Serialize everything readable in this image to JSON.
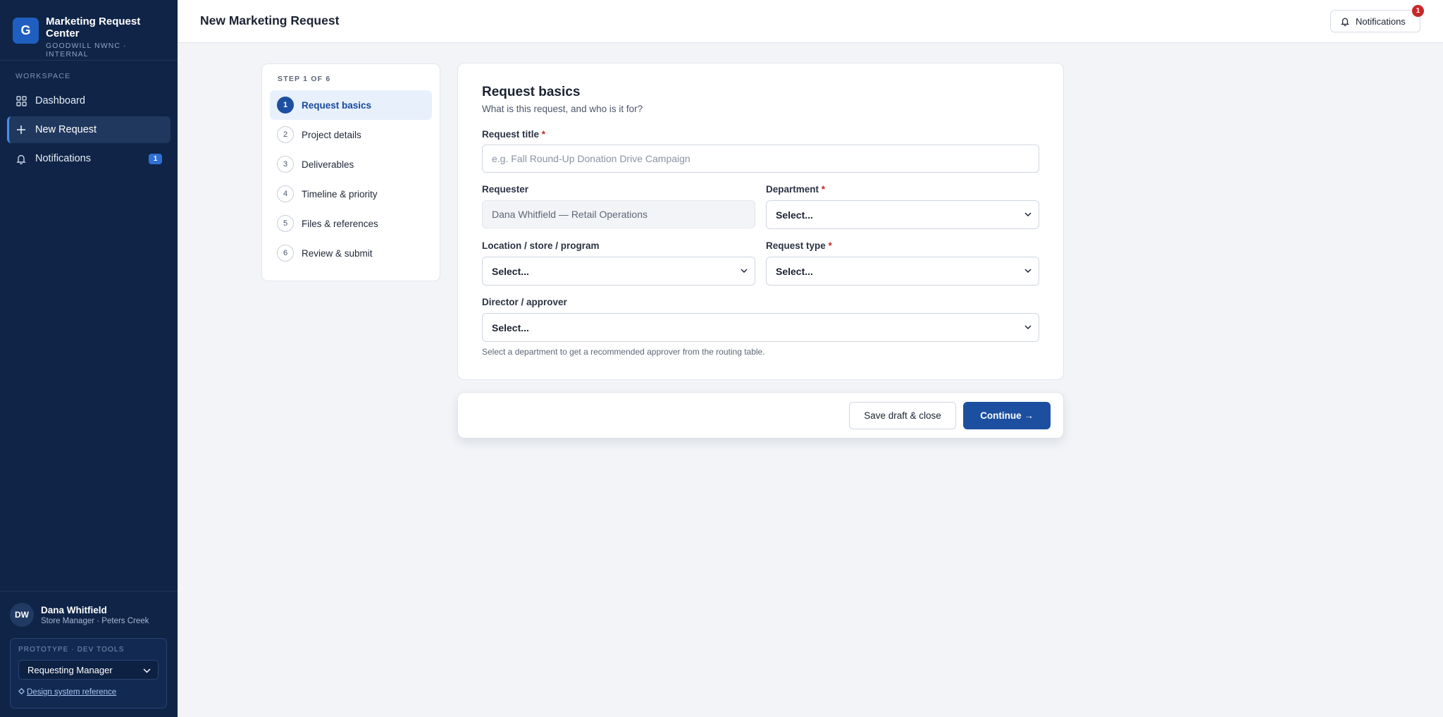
{
  "app": {
    "logo_letter": "G",
    "title": "Marketing Request Center",
    "subtitle": "GOODWILL NWNC · INTERNAL"
  },
  "sidebar": {
    "section_label": "WORKSPACE",
    "items": [
      {
        "label": "Dashboard",
        "icon": "grid-icon"
      },
      {
        "label": "New Request",
        "icon": "plus-icon",
        "active": true
      },
      {
        "label": "Notifications",
        "icon": "bell-icon",
        "badge": "1"
      }
    ],
    "user": {
      "initials": "DW",
      "name": "Dana Whitfield",
      "role": "Store Manager · Peters Creek"
    },
    "devtools": {
      "label": "PROTOTYPE · DEV TOOLS",
      "role_select": "Requesting Manager",
      "link": "Design system reference"
    }
  },
  "topbar": {
    "page_title": "New Marketing Request",
    "notifications_label": "Notifications",
    "notifications_count": "1"
  },
  "stepper": {
    "label": "STEP 1 OF 6",
    "steps": [
      {
        "num": "1",
        "label": "Request basics",
        "active": true
      },
      {
        "num": "2",
        "label": "Project details"
      },
      {
        "num": "3",
        "label": "Deliverables"
      },
      {
        "num": "4",
        "label": "Timeline & priority"
      },
      {
        "num": "5",
        "label": "Files & references"
      },
      {
        "num": "6",
        "label": "Review & submit"
      }
    ]
  },
  "form": {
    "title": "Request basics",
    "subtitle": "What is this request, and who is it for?",
    "request_title": {
      "label": "Request title",
      "required": "*",
      "placeholder": "e.g. Fall Round-Up Donation Drive Campaign"
    },
    "requester": {
      "label": "Requester",
      "value": "Dana Whitfield — Retail Operations"
    },
    "department": {
      "label": "Department",
      "required": "*",
      "value": "Select..."
    },
    "location": {
      "label": "Location / store / program",
      "value": "Select..."
    },
    "request_type": {
      "label": "Request type",
      "required": "*",
      "value": "Select..."
    },
    "director": {
      "label": "Director / approver",
      "value": "Select..."
    },
    "hint": "Select a department to get a recommended approver from the routing table."
  },
  "actions": {
    "save_label": "Save draft & close",
    "continue_label": "Continue →"
  }
}
